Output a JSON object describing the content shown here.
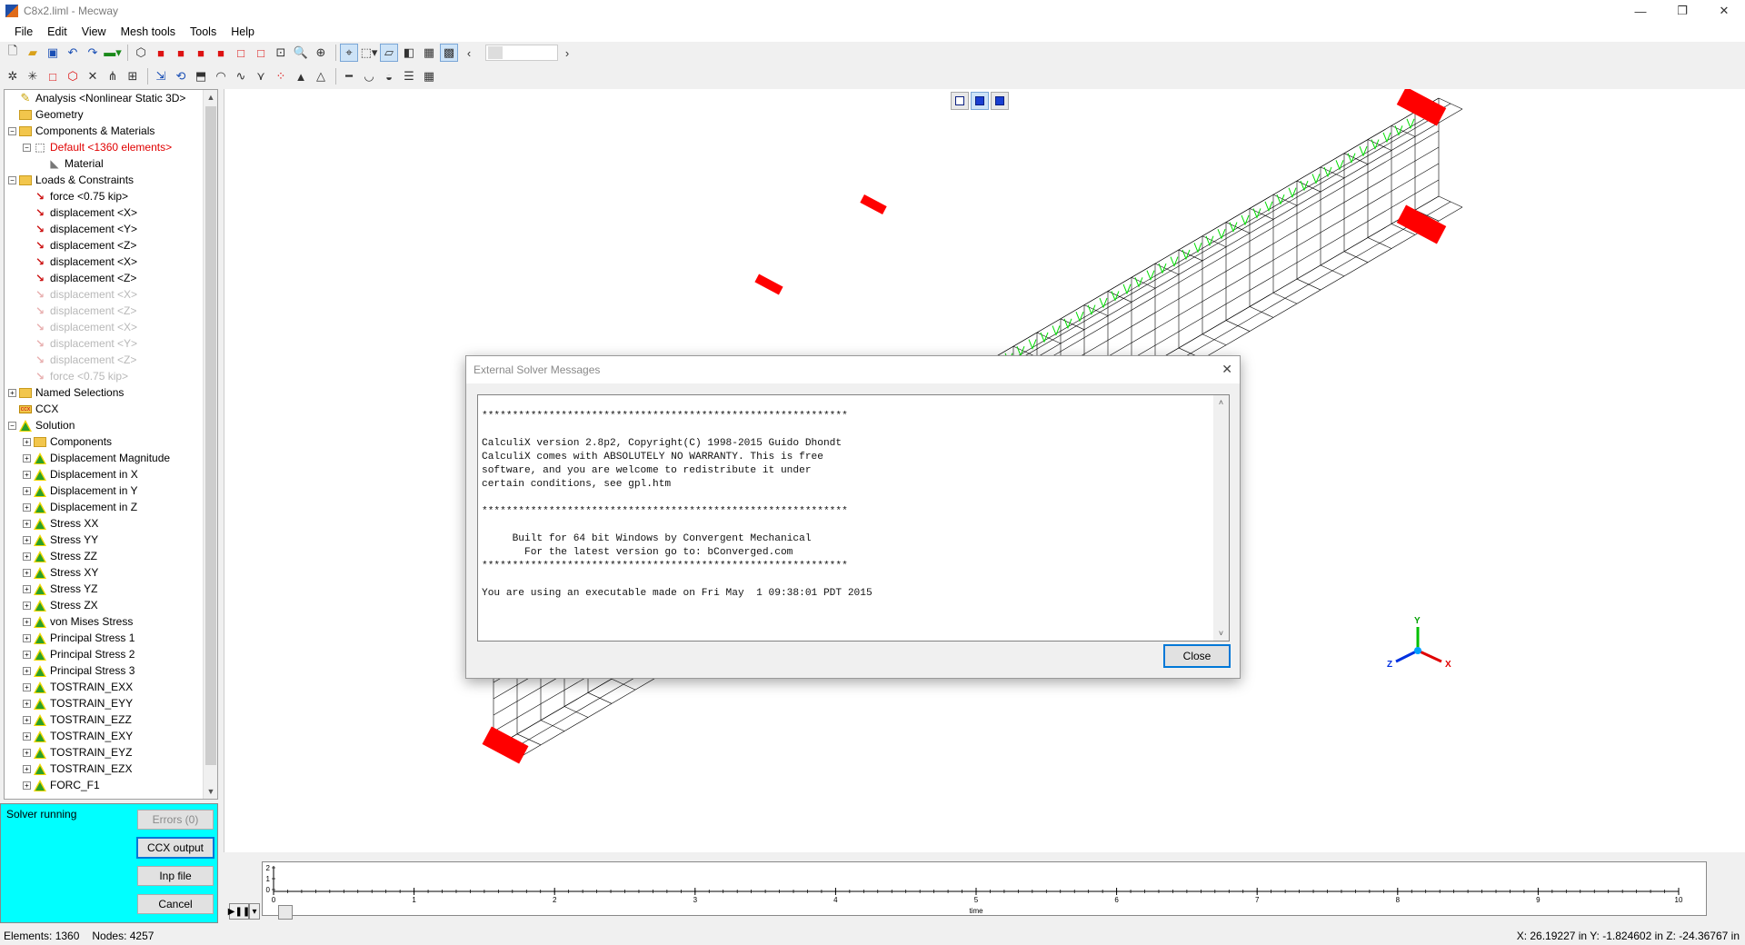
{
  "window": {
    "title": "C8x2.liml - Mecway",
    "controls": {
      "minimize": "—",
      "restore": "❐",
      "close": "✕"
    }
  },
  "menu": [
    "File",
    "Edit",
    "View",
    "Mesh tools",
    "Tools",
    "Help"
  ],
  "toolbar1_icons": [
    "new-icon",
    "open-icon",
    "save-icon",
    "undo-icon",
    "redo-icon",
    "color-icon",
    "sep",
    "cube-icon",
    "box-front-icon",
    "box-back-icon",
    "box-left-icon",
    "box-right-icon",
    "box-top-icon",
    "box-bottom-icon",
    "zoom-window-icon",
    "zoom-icon",
    "fit-icon",
    "sep",
    "select-icon",
    "select-mode-icon",
    "surface-icon",
    "solid-icon",
    "wireframe-icon",
    "shaded-icon",
    "arrow-left-icon"
  ],
  "toolbar2_icons": [
    "node-icon",
    "node-select-icon",
    "element-icon",
    "element3d-icon",
    "delete-icon",
    "split-icon",
    "merge-icon",
    "sep",
    "translate-icon",
    "rotate-icon",
    "extrude-icon",
    "revolve-icon",
    "sweep-icon",
    "refine-icon",
    "explode-icon",
    "triangle-icon",
    "triangle-outline-icon",
    "sep",
    "beam-icon",
    "curve-icon",
    "shell-icon",
    "layer-icon",
    "grid-icon"
  ],
  "tree": [
    {
      "label": "Analysis <Nonlinear Static 3D>",
      "level": 0,
      "expander": "",
      "icon": "analysis-icon",
      "style": "normal"
    },
    {
      "label": "Geometry",
      "level": 0,
      "expander": "",
      "icon": "folder-icon",
      "style": "normal"
    },
    {
      "label": "Components & Materials",
      "level": 0,
      "expander": "−",
      "icon": "components-icon",
      "style": "normal"
    },
    {
      "label": "Default <1360 elements>",
      "level": 1,
      "expander": "−",
      "icon": "component-icon",
      "style": "red"
    },
    {
      "label": "Material",
      "level": 2,
      "expander": "",
      "icon": "material-icon",
      "style": "normal"
    },
    {
      "label": "Loads & Constraints",
      "level": 0,
      "expander": "−",
      "icon": "folder-icon",
      "style": "normal"
    },
    {
      "label": "force <0.75 kip>",
      "level": 1,
      "expander": "",
      "icon": "load-icon",
      "style": "normal"
    },
    {
      "label": "displacement <X>",
      "level": 1,
      "expander": "",
      "icon": "load-icon",
      "style": "normal"
    },
    {
      "label": "displacement <Y>",
      "level": 1,
      "expander": "",
      "icon": "load-icon",
      "style": "normal"
    },
    {
      "label": "displacement <Z>",
      "level": 1,
      "expander": "",
      "icon": "load-icon",
      "style": "normal"
    },
    {
      "label": "displacement <X>",
      "level": 1,
      "expander": "",
      "icon": "load-icon",
      "style": "normal"
    },
    {
      "label": "displacement <Z>",
      "level": 1,
      "expander": "",
      "icon": "load-icon",
      "style": "normal"
    },
    {
      "label": "displacement <X>",
      "level": 1,
      "expander": "",
      "icon": "load-icon",
      "style": "disabled"
    },
    {
      "label": "displacement <Z>",
      "level": 1,
      "expander": "",
      "icon": "load-icon",
      "style": "disabled"
    },
    {
      "label": "displacement <X>",
      "level": 1,
      "expander": "",
      "icon": "load-icon",
      "style": "disabled"
    },
    {
      "label": "displacement <Y>",
      "level": 1,
      "expander": "",
      "icon": "load-icon",
      "style": "disabled"
    },
    {
      "label": "displacement <Z>",
      "level": 1,
      "expander": "",
      "icon": "load-icon",
      "style": "disabled"
    },
    {
      "label": "force <0.75 kip>",
      "level": 1,
      "expander": "",
      "icon": "load-icon",
      "style": "disabled"
    },
    {
      "label": "Named Selections",
      "level": 0,
      "expander": "+",
      "icon": "folder-icon",
      "style": "normal"
    },
    {
      "label": "CCX",
      "level": 0,
      "expander": "",
      "icon": "ccx-icon",
      "style": "normal"
    },
    {
      "label": "Solution",
      "level": 0,
      "expander": "−",
      "icon": "solution-icon",
      "style": "normal"
    },
    {
      "label": "Components",
      "level": 1,
      "expander": "+",
      "icon": "components-icon",
      "style": "normal"
    },
    {
      "label": "Displacement Magnitude",
      "level": 1,
      "expander": "+",
      "icon": "result-icon",
      "style": "normal"
    },
    {
      "label": "Displacement in X",
      "level": 1,
      "expander": "+",
      "icon": "result-icon",
      "style": "normal"
    },
    {
      "label": "Displacement in Y",
      "level": 1,
      "expander": "+",
      "icon": "result-icon",
      "style": "normal"
    },
    {
      "label": "Displacement in Z",
      "level": 1,
      "expander": "+",
      "icon": "result-icon",
      "style": "normal"
    },
    {
      "label": "Stress XX",
      "level": 1,
      "expander": "+",
      "icon": "result-icon",
      "style": "normal"
    },
    {
      "label": "Stress YY",
      "level": 1,
      "expander": "+",
      "icon": "result-icon",
      "style": "normal"
    },
    {
      "label": "Stress ZZ",
      "level": 1,
      "expander": "+",
      "icon": "result-icon",
      "style": "normal"
    },
    {
      "label": "Stress XY",
      "level": 1,
      "expander": "+",
      "icon": "result-icon",
      "style": "normal"
    },
    {
      "label": "Stress YZ",
      "level": 1,
      "expander": "+",
      "icon": "result-icon",
      "style": "normal"
    },
    {
      "label": "Stress ZX",
      "level": 1,
      "expander": "+",
      "icon": "result-icon",
      "style": "normal"
    },
    {
      "label": "von Mises Stress",
      "level": 1,
      "expander": "+",
      "icon": "result-icon",
      "style": "normal"
    },
    {
      "label": "Principal Stress 1",
      "level": 1,
      "expander": "+",
      "icon": "result-icon",
      "style": "normal"
    },
    {
      "label": "Principal Stress 2",
      "level": 1,
      "expander": "+",
      "icon": "result-icon",
      "style": "normal"
    },
    {
      "label": "Principal Stress 3",
      "level": 1,
      "expander": "+",
      "icon": "result-icon",
      "style": "normal"
    },
    {
      "label": "TOSTRAIN_EXX",
      "level": 1,
      "expander": "+",
      "icon": "result-icon",
      "style": "normal"
    },
    {
      "label": "TOSTRAIN_EYY",
      "level": 1,
      "expander": "+",
      "icon": "result-icon",
      "style": "normal"
    },
    {
      "label": "TOSTRAIN_EZZ",
      "level": 1,
      "expander": "+",
      "icon": "result-icon",
      "style": "normal"
    },
    {
      "label": "TOSTRAIN_EXY",
      "level": 1,
      "expander": "+",
      "icon": "result-icon",
      "style": "normal"
    },
    {
      "label": "TOSTRAIN_EYZ",
      "level": 1,
      "expander": "+",
      "icon": "result-icon",
      "style": "normal"
    },
    {
      "label": "TOSTRAIN_EZX",
      "level": 1,
      "expander": "+",
      "icon": "result-icon",
      "style": "normal"
    },
    {
      "label": "FORC_F1",
      "level": 1,
      "expander": "+",
      "icon": "result-icon",
      "style": "normal"
    }
  ],
  "solver": {
    "status": "Solver running",
    "errors_button": "Errors (0)",
    "ccx_output_button": "CCX output",
    "inp_file_button": "Inp file",
    "cancel_button": "Cancel"
  },
  "timeline": {
    "y_ticks": [
      "2",
      "1",
      "0"
    ],
    "x_ticks": [
      "0",
      "1",
      "2",
      "3",
      "4",
      "5",
      "6",
      "7",
      "8",
      "9",
      "10"
    ],
    "x_label": "time",
    "play_label": "▶❚❚",
    "dropdown_label": "▾"
  },
  "statusbar": {
    "elements": "Elements:  1360",
    "nodes": "Nodes: 4257",
    "coords": "X: 26.19227 in Y: -1.824602 in Z: -24.36767 in"
  },
  "axes_triad": {
    "x": "X",
    "y": "Y",
    "z": "Z"
  },
  "dialog": {
    "title": "External Solver Messages",
    "close_x": "✕",
    "close_button": "Close",
    "lines": [
      "************************************************************",
      "",
      "CalculiX version 2.8p2, Copyright(C) 1998-2015 Guido Dhondt",
      "CalculiX comes with ABSOLUTELY NO WARRANTY. This is free",
      "software, and you are welcome to redistribute it under",
      "certain conditions, see gpl.htm",
      "",
      "************************************************************",
      "",
      "     Built for 64 bit Windows by Convergent Mechanical",
      "       For the latest version go to: bConverged.com",
      "************************************************************",
      "",
      "You are using an executable made on Fri May  1 09:38:01 PDT 2015"
    ]
  },
  "colors": {
    "solver_panel": "#00ffff",
    "mesh": "#000000",
    "load_arrows": "#00dd00",
    "constraints": "#ff0000",
    "selected_tree_item": "#e00000"
  }
}
